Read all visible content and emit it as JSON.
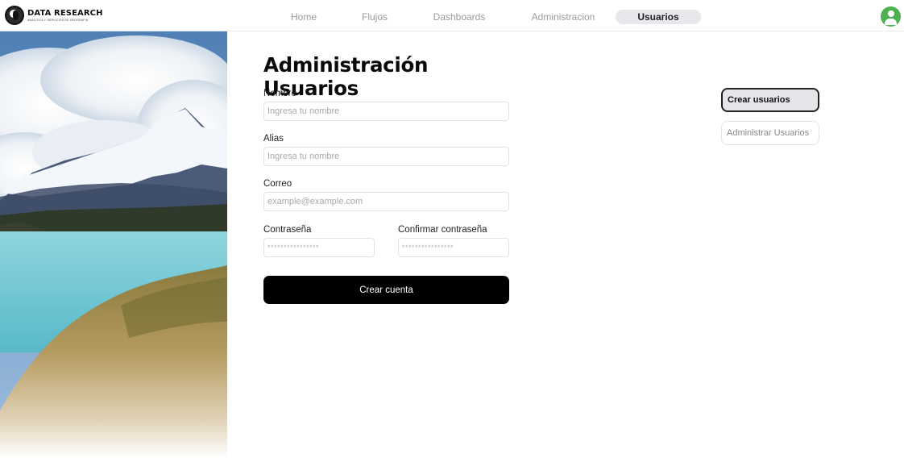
{
  "header": {
    "logo_title": "DATA RESEARCH",
    "logo_subtitle": "ANALITICA Y SERVICIOS DE GEOGRAFIA",
    "nav": [
      {
        "label": "Home"
      },
      {
        "label": "Flujos"
      },
      {
        "label": "Dashboards"
      },
      {
        "label": "Administracion"
      },
      {
        "label": "Usuarios",
        "active": true
      }
    ],
    "avatar_icon": "user-icon",
    "avatar_color": "#4caf50"
  },
  "form": {
    "title": "Administración Usuarios",
    "nombre": {
      "label": "Nombre",
      "placeholder": "Ingresa tu nombre"
    },
    "alias": {
      "label": "Alias",
      "placeholder": "Ingresa tu nombre"
    },
    "correo": {
      "label": "Correo",
      "placeholder": "example@example.com"
    },
    "password": {
      "label": "Contraseña",
      "placeholder": "****************"
    },
    "confirm_password": {
      "label": "Confirmar contraseña",
      "placeholder": "****************"
    },
    "submit_label": "Crear cuenta"
  },
  "sidebar_actions": {
    "create_label": "Crear usuarios",
    "manage_label": "Administrar Usuarios"
  },
  "colors": {
    "accent": "#000000",
    "active_nav_bg": "#e6e8ec"
  }
}
